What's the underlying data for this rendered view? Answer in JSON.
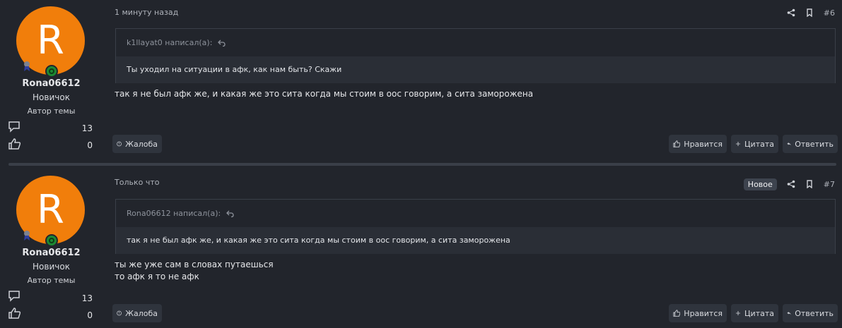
{
  "posts": [
    {
      "user": {
        "initial": "R",
        "avatar_color": "#f17e0b",
        "username": "Rona06612",
        "rank": "Новичок",
        "role": "Автор темы",
        "messages": "13",
        "reactions": "0"
      },
      "time": "1 минуту назад",
      "badge": "",
      "post_number": "#6",
      "quote": {
        "author": "k1llayat0 написал(а):",
        "text": "Ты уходил на ситуации в афк, как нам быть? Скажи"
      },
      "message_lines": [
        "так я не был афк же, и какая же это сита когда мы стоим в оос говорим, а сита заморожена"
      ],
      "actions": {
        "report": "Жалоба",
        "like": "Нравится",
        "quote": "Цитата",
        "reply": "Ответить"
      }
    },
    {
      "user": {
        "initial": "R",
        "avatar_color": "#f17e0b",
        "username": "Rona06612",
        "rank": "Новичок",
        "role": "Автор темы",
        "messages": "13",
        "reactions": "0"
      },
      "time": "Только что",
      "badge": "Новое",
      "post_number": "#7",
      "quote": {
        "author": "Rona06612 написал(а):",
        "text": "так я не был афк же, и какая же это сита когда мы стоим в оос говорим, а сита заморожена"
      },
      "message_lines": [
        "ты же уже сам в словах путаешься",
        "то афк я то не афк"
      ],
      "actions": {
        "report": "Жалоба",
        "like": "Нравится",
        "quote": "Цитата",
        "reply": "Ответить"
      }
    }
  ],
  "icons": [
    "award-icon",
    "online-status-icon",
    "messages-icon",
    "likes-icon",
    "share-icon",
    "bookmark-icon",
    "quote-jump-icon",
    "report-icon",
    "like-icon",
    "plus-icon",
    "reply-icon"
  ],
  "colors": {
    "background": "#22252c",
    "avatar": "#f17e0b",
    "online": "#1c8a33",
    "button": "#2f343d"
  }
}
